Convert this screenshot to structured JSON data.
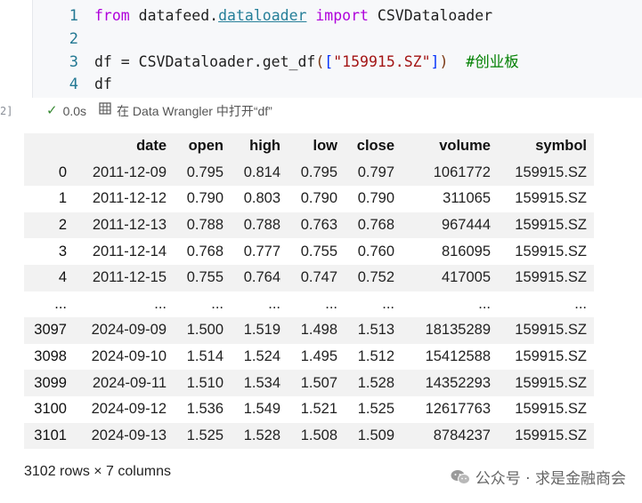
{
  "cell": {
    "exec_count": "2]",
    "lines": [
      {
        "num": "1"
      },
      {
        "num": "2"
      },
      {
        "num": "3"
      },
      {
        "num": "4"
      }
    ],
    "code": {
      "l1_from": "from",
      "l1_module_a": " datafeed.",
      "l1_module_b": "dataloader",
      "l1_import": " import",
      "l1_name": " CSVDataloader",
      "l3_prefix": "df = CSVDataloader.get_df",
      "l3_paren_open": "(",
      "l3_bracket_open": "[",
      "l3_string": "\"159915.SZ\"",
      "l3_bracket_close": "]",
      "l3_paren_close": ")",
      "l3_comment": "  #创业板",
      "l4": "df"
    },
    "status": {
      "time": "0.0s",
      "wrangler_icon": "grid-icon",
      "wrangler_label": "在 Data Wrangler 中打开“df”"
    }
  },
  "table": {
    "columns": [
      "",
      "date",
      "open",
      "high",
      "low",
      "close",
      "volume",
      "symbol"
    ],
    "rows": [
      [
        "0",
        "2011-12-09",
        "0.795",
        "0.814",
        "0.795",
        "0.797",
        "1061772",
        "159915.SZ"
      ],
      [
        "1",
        "2011-12-12",
        "0.790",
        "0.803",
        "0.790",
        "0.790",
        "311065",
        "159915.SZ"
      ],
      [
        "2",
        "2011-12-13",
        "0.788",
        "0.788",
        "0.763",
        "0.768",
        "967444",
        "159915.SZ"
      ],
      [
        "3",
        "2011-12-14",
        "0.768",
        "0.777",
        "0.755",
        "0.760",
        "816095",
        "159915.SZ"
      ],
      [
        "4",
        "2011-12-15",
        "0.755",
        "0.764",
        "0.747",
        "0.752",
        "417005",
        "159915.SZ"
      ],
      [
        "...",
        "...",
        "...",
        "...",
        "...",
        "...",
        "...",
        "..."
      ],
      [
        "3097",
        "2024-09-09",
        "1.500",
        "1.519",
        "1.498",
        "1.513",
        "18135289",
        "159915.SZ"
      ],
      [
        "3098",
        "2024-09-10",
        "1.514",
        "1.524",
        "1.495",
        "1.512",
        "15412588",
        "159915.SZ"
      ],
      [
        "3099",
        "2024-09-11",
        "1.510",
        "1.534",
        "1.507",
        "1.528",
        "14352293",
        "159915.SZ"
      ],
      [
        "3100",
        "2024-09-12",
        "1.536",
        "1.549",
        "1.521",
        "1.525",
        "12617763",
        "159915.SZ"
      ],
      [
        "3101",
        "2024-09-13",
        "1.525",
        "1.528",
        "1.508",
        "1.509",
        "8784237",
        "159915.SZ"
      ]
    ],
    "summary": "3102 rows × 7 columns"
  },
  "watermark": {
    "text": "公众号 · 求是金融商会",
    "icon": "wechat-icon"
  }
}
